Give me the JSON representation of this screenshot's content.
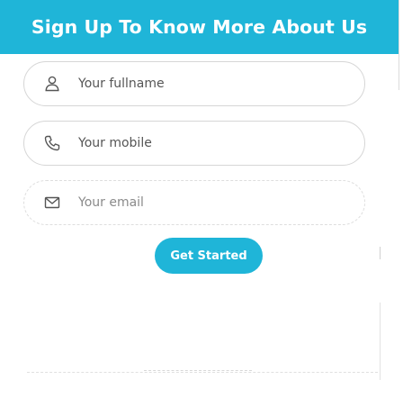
{
  "header": {
    "title": "Sign Up To Know More About Us"
  },
  "form": {
    "fullname": {
      "placeholder": "Your fullname",
      "icon": "user-icon"
    },
    "mobile": {
      "placeholder": "Your mobile",
      "icon": "phone-icon"
    },
    "email": {
      "placeholder": "Your email",
      "icon": "mail-icon"
    },
    "submit_label": "Get Started"
  },
  "colors": {
    "accent": "#1fb5d8",
    "field_border": "#d6d6d6",
    "icon": "#555555"
  }
}
